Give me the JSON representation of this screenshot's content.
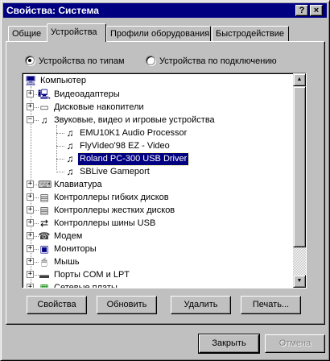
{
  "window": {
    "title": "Свойства: Система",
    "help_button": "?",
    "close_button": "×"
  },
  "tabs": [
    {
      "label": "Общие",
      "active": false
    },
    {
      "label": "Устройства",
      "active": true
    },
    {
      "label": "Профили оборудования",
      "active": false
    },
    {
      "label": "Быстродействие",
      "active": false
    }
  ],
  "view_mode": {
    "by_type": {
      "label": "Устройства по типам",
      "selected": true
    },
    "by_connection": {
      "label": "Устройства по подключению",
      "selected": false
    }
  },
  "tree": {
    "root": {
      "label": "Компьютер",
      "icon": "computer-icon"
    },
    "items": [
      {
        "label": "Видеоадаптеры",
        "icon": "display-adapter-icon",
        "expander": "+",
        "level": 1
      },
      {
        "label": "Дисковые накопители",
        "icon": "disk-drive-icon",
        "expander": "+",
        "level": 1
      },
      {
        "label": "Звуковые, видео и игровые устройства",
        "icon": "sound-device-icon",
        "expander": "−",
        "level": 1
      },
      {
        "label": "EMU10K1 Audio Processor",
        "icon": "sound-device-icon",
        "expander": "",
        "level": 2
      },
      {
        "label": "FlyVideo'98 EZ - Video",
        "icon": "sound-device-icon",
        "expander": "",
        "level": 2
      },
      {
        "label": "Roland PC-300 USB Driver",
        "icon": "sound-device-icon",
        "expander": "",
        "level": 2,
        "selected": true
      },
      {
        "label": "SBLive Gameport",
        "icon": "sound-device-icon",
        "expander": "",
        "level": 2
      },
      {
        "label": "Клавиатура",
        "icon": "keyboard-icon",
        "expander": "+",
        "level": 1
      },
      {
        "label": "Контроллеры гибких дисков",
        "icon": "floppy-controller-icon",
        "expander": "+",
        "level": 1
      },
      {
        "label": "Контроллеры жестких дисков",
        "icon": "hdd-controller-icon",
        "expander": "+",
        "level": 1
      },
      {
        "label": "Контроллеры шины USB",
        "icon": "usb-icon",
        "expander": "+",
        "level": 1
      },
      {
        "label": "Модем",
        "icon": "modem-icon",
        "expander": "+",
        "level": 1
      },
      {
        "label": "Мониторы",
        "icon": "monitor-icon",
        "expander": "+",
        "level": 1
      },
      {
        "label": "Мышь",
        "icon": "mouse-icon",
        "expander": "+",
        "level": 1
      },
      {
        "label": "Порты COM и LPT",
        "icon": "port-icon",
        "expander": "+",
        "level": 1
      },
      {
        "label": "Сетевые платы",
        "icon": "network-card-icon",
        "expander": "+",
        "level": 1
      }
    ]
  },
  "scrollbar": {
    "up": "▲",
    "down": "▼"
  },
  "buttons": {
    "properties": "Свойства",
    "refresh": "Обновить",
    "remove": "Удалить",
    "print": "Печать..."
  },
  "dialog_buttons": {
    "close": "Закрыть",
    "cancel": "Отмена"
  },
  "colors": {
    "title_bar": "#000080",
    "face": "#c0c0c0",
    "selection": "#000080"
  }
}
